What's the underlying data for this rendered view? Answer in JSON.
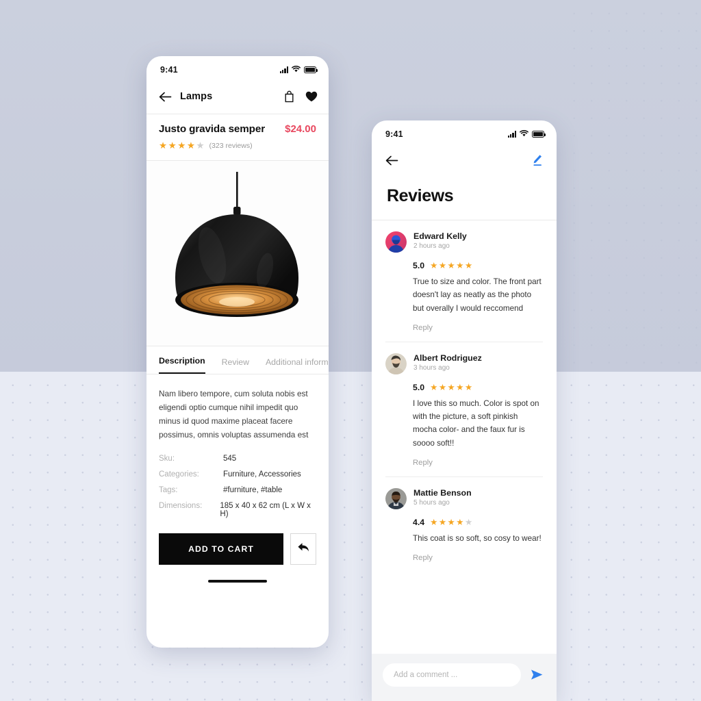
{
  "background": {
    "top_color": "#c8cddc",
    "bottom_color": "#e8ebf4",
    "dot_color": "#c2c8da"
  },
  "product_screen": {
    "status_bar": {
      "time": "9:41",
      "icons": [
        "signal-icon",
        "wifi-icon",
        "battery-icon"
      ]
    },
    "nav": {
      "back_icon": "arrow-left-icon",
      "title": "Lamps",
      "bag_icon": "shopping-bag-icon",
      "favorite_icon": "heart-icon"
    },
    "product": {
      "title": "Justo gravida semper",
      "price": "$24.00",
      "price_color": "#e8485f",
      "rating": 4,
      "rating_max": 5,
      "star_color": "#f5a623",
      "review_count_label": "(323 reviews)",
      "image_alt": "black-pendant-lamp"
    },
    "tabs": [
      {
        "label": "Description",
        "active": true
      },
      {
        "label": "Review",
        "active": false
      },
      {
        "label": "Additional informa",
        "active": false
      }
    ],
    "description": "Nam libero tempore, cum soluta nobis est eligendi optio cumque nihil impedit quo minus id quod maxime placeat facere possimus, omnis voluptas assumenda est",
    "specs": [
      {
        "key": "Sku:",
        "value": "545"
      },
      {
        "key": "Categories:",
        "value": "Furniture, Accessories"
      },
      {
        "key": "Tags:",
        "value": "#furniture, #table"
      },
      {
        "key": "Dimensions:",
        "value": "185 x 40 x 62 cm (L x W x H)"
      }
    ],
    "cta": {
      "add_to_cart_label": "ADD TO CART",
      "share_icon": "share-arrow-icon"
    }
  },
  "reviews_screen": {
    "status_bar": {
      "time": "9:41",
      "icons": [
        "signal-icon",
        "wifi-icon",
        "battery-icon"
      ]
    },
    "nav": {
      "back_icon": "arrow-left-icon",
      "edit_icon": "pencil-icon",
      "edit_icon_color": "#2f80ed"
    },
    "heading": "Reviews",
    "reviews": [
      {
        "name": "Edward Kelly",
        "time": "2 hours ago",
        "score": "5.0",
        "stars": 5,
        "text": "True to size and color. The front part doesn't lay as neatly as the photo but overally I would reccomend",
        "reply_label": "Reply",
        "avatar": "avatar-edward-kelly"
      },
      {
        "name": "Albert Rodriguez",
        "time": "3 hours ago",
        "score": "5.0",
        "stars": 5,
        "text": "I love this so much. Color is spot on with the picture, a soft pinkish mocha color- and the faux fur is soooo soft!!",
        "reply_label": "Reply",
        "avatar": "avatar-albert-rodriguez"
      },
      {
        "name": "Mattie Benson",
        "time": "5 hours ago",
        "score": "4.4",
        "stars": 4,
        "text": "This coat is so soft, so cosy to wear!",
        "reply_label": "Reply",
        "avatar": "avatar-mattie-benson"
      }
    ],
    "comment_bar": {
      "placeholder": "Add a comment ...",
      "send_icon": "send-arrow-icon",
      "send_color": "#2f80ed"
    }
  }
}
